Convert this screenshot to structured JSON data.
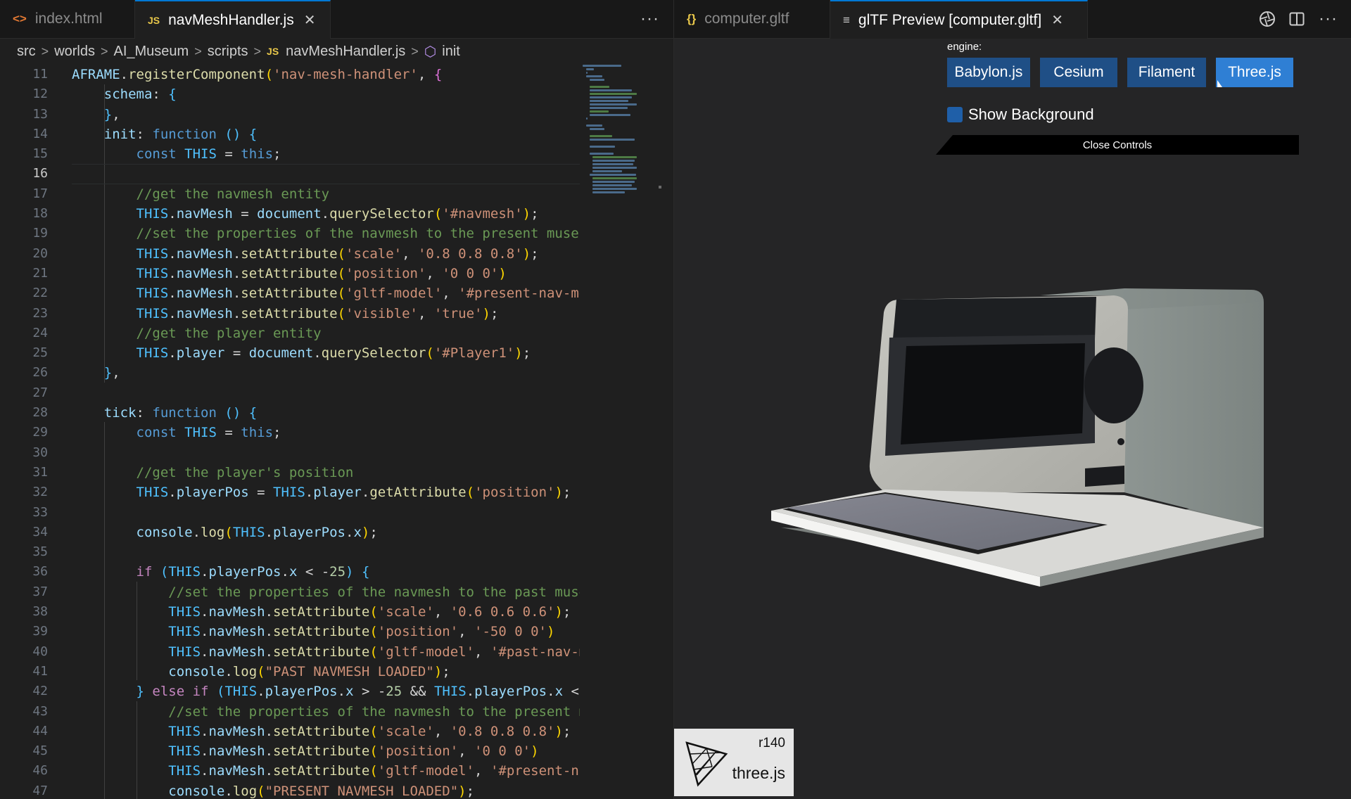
{
  "editor_tabs": [
    {
      "icon": "<>",
      "label": "index.html",
      "active": false
    },
    {
      "icon": "JS",
      "label": "navMeshHandler.js",
      "active": true
    }
  ],
  "preview_tabs": [
    {
      "icon": "{}",
      "label": "computer.gltf",
      "active": false
    },
    {
      "icon": "≡",
      "label": "glTF Preview [computer.gltf]",
      "active": true
    }
  ],
  "more_actions": "···",
  "breadcrumbs": [
    "src",
    "worlds",
    "AI_Museum",
    "scripts",
    "navMeshHandler.js",
    "init"
  ],
  "line_numbers": [
    "11",
    "12",
    "13",
    "14",
    "15",
    "16",
    "17",
    "18",
    "19",
    "20",
    "21",
    "22",
    "23",
    "24",
    "25",
    "26",
    "27",
    "28",
    "29",
    "30",
    "31",
    "32",
    "33",
    "34",
    "35",
    "36",
    "37",
    "38",
    "39",
    "40",
    "41",
    "42",
    "43",
    "44",
    "45",
    "46",
    "47"
  ],
  "current_line": "16",
  "code_lines": [
    [
      [
        "v",
        "AFRAME"
      ],
      [
        "d",
        "."
      ],
      [
        "f",
        "registerComponent"
      ],
      [
        "b",
        "("
      ],
      [
        "s",
        "'nav-mesh-handler'"
      ],
      [
        "d",
        ", "
      ],
      [
        "p",
        "{"
      ]
    ],
    [
      [
        "d",
        "    "
      ],
      [
        "v",
        "schema"
      ],
      [
        "d",
        ": "
      ],
      [
        "n",
        "{"
      ]
    ],
    [
      [
        "d",
        "    "
      ],
      [
        "n",
        "}"
      ],
      [
        "d",
        ","
      ]
    ],
    [
      [
        "d",
        "    "
      ],
      [
        "v",
        "init"
      ],
      [
        "d",
        ": "
      ],
      [
        "k",
        "function"
      ],
      [
        "d",
        " "
      ],
      [
        "n",
        "()"
      ],
      [
        "d",
        " "
      ],
      [
        "n",
        "{"
      ]
    ],
    [
      [
        "d",
        "        "
      ],
      [
        "k",
        "const"
      ],
      [
        "d",
        " "
      ],
      [
        "n",
        "THIS"
      ],
      [
        "d",
        " = "
      ],
      [
        "k",
        "this"
      ],
      [
        "d",
        ";"
      ]
    ],
    [
      [
        "d",
        ""
      ]
    ],
    [
      [
        "d",
        "        "
      ],
      [
        "c",
        "//get the navmesh entity"
      ]
    ],
    [
      [
        "d",
        "        "
      ],
      [
        "n",
        "THIS"
      ],
      [
        "d",
        "."
      ],
      [
        "v",
        "navMesh"
      ],
      [
        "d",
        " = "
      ],
      [
        "v",
        "document"
      ],
      [
        "d",
        "."
      ],
      [
        "f",
        "querySelector"
      ],
      [
        "b",
        "("
      ],
      [
        "s",
        "'#navmesh'"
      ],
      [
        "b",
        ")"
      ],
      [
        "d",
        ";"
      ]
    ],
    [
      [
        "d",
        "        "
      ],
      [
        "c",
        "//set the properties of the navmesh to the present museu"
      ]
    ],
    [
      [
        "d",
        "        "
      ],
      [
        "n",
        "THIS"
      ],
      [
        "d",
        "."
      ],
      [
        "v",
        "navMesh"
      ],
      [
        "d",
        "."
      ],
      [
        "f",
        "setAttribute"
      ],
      [
        "b",
        "("
      ],
      [
        "s",
        "'scale'"
      ],
      [
        "d",
        ", "
      ],
      [
        "s",
        "'0.8 0.8 0.8'"
      ],
      [
        "b",
        ")"
      ],
      [
        "d",
        ";"
      ]
    ],
    [
      [
        "d",
        "        "
      ],
      [
        "n",
        "THIS"
      ],
      [
        "d",
        "."
      ],
      [
        "v",
        "navMesh"
      ],
      [
        "d",
        "."
      ],
      [
        "f",
        "setAttribute"
      ],
      [
        "b",
        "("
      ],
      [
        "s",
        "'position'"
      ],
      [
        "d",
        ", "
      ],
      [
        "s",
        "'0 0 0'"
      ],
      [
        "b",
        ")"
      ]
    ],
    [
      [
        "d",
        "        "
      ],
      [
        "n",
        "THIS"
      ],
      [
        "d",
        "."
      ],
      [
        "v",
        "navMesh"
      ],
      [
        "d",
        "."
      ],
      [
        "f",
        "setAttribute"
      ],
      [
        "b",
        "("
      ],
      [
        "s",
        "'gltf-model'"
      ],
      [
        "d",
        ", "
      ],
      [
        "s",
        "'#present-nav-me"
      ]
    ],
    [
      [
        "d",
        "        "
      ],
      [
        "n",
        "THIS"
      ],
      [
        "d",
        "."
      ],
      [
        "v",
        "navMesh"
      ],
      [
        "d",
        "."
      ],
      [
        "f",
        "setAttribute"
      ],
      [
        "b",
        "("
      ],
      [
        "s",
        "'visible'"
      ],
      [
        "d",
        ", "
      ],
      [
        "s",
        "'true'"
      ],
      [
        "b",
        ")"
      ],
      [
        "d",
        ";"
      ]
    ],
    [
      [
        "d",
        "        "
      ],
      [
        "c",
        "//get the player entity"
      ]
    ],
    [
      [
        "d",
        "        "
      ],
      [
        "n",
        "THIS"
      ],
      [
        "d",
        "."
      ],
      [
        "v",
        "player"
      ],
      [
        "d",
        " = "
      ],
      [
        "v",
        "document"
      ],
      [
        "d",
        "."
      ],
      [
        "f",
        "querySelector"
      ],
      [
        "b",
        "("
      ],
      [
        "s",
        "'#Player1'"
      ],
      [
        "b",
        ")"
      ],
      [
        "d",
        ";"
      ]
    ],
    [
      [
        "d",
        "    "
      ],
      [
        "n",
        "}"
      ],
      [
        "d",
        ","
      ]
    ],
    [
      [
        "d",
        ""
      ]
    ],
    [
      [
        "d",
        "    "
      ],
      [
        "v",
        "tick"
      ],
      [
        "d",
        ": "
      ],
      [
        "k",
        "function"
      ],
      [
        "d",
        " "
      ],
      [
        "n",
        "()"
      ],
      [
        "d",
        " "
      ],
      [
        "n",
        "{"
      ]
    ],
    [
      [
        "d",
        "        "
      ],
      [
        "k",
        "const"
      ],
      [
        "d",
        " "
      ],
      [
        "n",
        "THIS"
      ],
      [
        "d",
        " = "
      ],
      [
        "k",
        "this"
      ],
      [
        "d",
        ";"
      ]
    ],
    [
      [
        "d",
        ""
      ]
    ],
    [
      [
        "d",
        "        "
      ],
      [
        "c",
        "//get the player's position"
      ]
    ],
    [
      [
        "d",
        "        "
      ],
      [
        "n",
        "THIS"
      ],
      [
        "d",
        "."
      ],
      [
        "v",
        "playerPos"
      ],
      [
        "d",
        " = "
      ],
      [
        "n",
        "THIS"
      ],
      [
        "d",
        "."
      ],
      [
        "v",
        "player"
      ],
      [
        "d",
        "."
      ],
      [
        "f",
        "getAttribute"
      ],
      [
        "b",
        "("
      ],
      [
        "s",
        "'position'"
      ],
      [
        "b",
        ")"
      ],
      [
        "d",
        ";"
      ]
    ],
    [
      [
        "d",
        ""
      ]
    ],
    [
      [
        "d",
        "        "
      ],
      [
        "v",
        "console"
      ],
      [
        "d",
        "."
      ],
      [
        "f",
        "log"
      ],
      [
        "b",
        "("
      ],
      [
        "n",
        "THIS"
      ],
      [
        "d",
        "."
      ],
      [
        "v",
        "playerPos"
      ],
      [
        "d",
        "."
      ],
      [
        "v",
        "x"
      ],
      [
        "b",
        ")"
      ],
      [
        "d",
        ";"
      ]
    ],
    [
      [
        "d",
        ""
      ]
    ],
    [
      [
        "d",
        "        "
      ],
      [
        "ctl",
        "if"
      ],
      [
        "d",
        " "
      ],
      [
        "n",
        "("
      ],
      [
        "n",
        "THIS"
      ],
      [
        "d",
        "."
      ],
      [
        "v",
        "playerPos"
      ],
      [
        "d",
        "."
      ],
      [
        "v",
        "x"
      ],
      [
        "d",
        " < -"
      ],
      [
        "num",
        "25"
      ],
      [
        "n",
        ")"
      ],
      [
        "d",
        " "
      ],
      [
        "n",
        "{"
      ]
    ],
    [
      [
        "d",
        "            "
      ],
      [
        "c",
        "//set the properties of the navmesh to the past muse"
      ]
    ],
    [
      [
        "d",
        "            "
      ],
      [
        "n",
        "THIS"
      ],
      [
        "d",
        "."
      ],
      [
        "v",
        "navMesh"
      ],
      [
        "d",
        "."
      ],
      [
        "f",
        "setAttribute"
      ],
      [
        "b",
        "("
      ],
      [
        "s",
        "'scale'"
      ],
      [
        "d",
        ", "
      ],
      [
        "s",
        "'0.6 0.6 0.6'"
      ],
      [
        "b",
        ")"
      ],
      [
        "d",
        ";"
      ]
    ],
    [
      [
        "d",
        "            "
      ],
      [
        "n",
        "THIS"
      ],
      [
        "d",
        "."
      ],
      [
        "v",
        "navMesh"
      ],
      [
        "d",
        "."
      ],
      [
        "f",
        "setAttribute"
      ],
      [
        "b",
        "("
      ],
      [
        "s",
        "'position'"
      ],
      [
        "d",
        ", "
      ],
      [
        "s",
        "'-50 0 0'"
      ],
      [
        "b",
        ")"
      ]
    ],
    [
      [
        "d",
        "            "
      ],
      [
        "n",
        "THIS"
      ],
      [
        "d",
        "."
      ],
      [
        "v",
        "navMesh"
      ],
      [
        "d",
        "."
      ],
      [
        "f",
        "setAttribute"
      ],
      [
        "b",
        "("
      ],
      [
        "s",
        "'gltf-model'"
      ],
      [
        "d",
        ", "
      ],
      [
        "s",
        "'#past-nav-m"
      ]
    ],
    [
      [
        "d",
        "            "
      ],
      [
        "v",
        "console"
      ],
      [
        "d",
        "."
      ],
      [
        "f",
        "log"
      ],
      [
        "b",
        "("
      ],
      [
        "s",
        "\"PAST NAVMESH LOADED\""
      ],
      [
        "b",
        ")"
      ],
      [
        "d",
        ";"
      ]
    ],
    [
      [
        "d",
        "        "
      ],
      [
        "n",
        "}"
      ],
      [
        "d",
        " "
      ],
      [
        "ctl",
        "else"
      ],
      [
        "d",
        " "
      ],
      [
        "ctl",
        "if"
      ],
      [
        "d",
        " "
      ],
      [
        "n",
        "("
      ],
      [
        "n",
        "THIS"
      ],
      [
        "d",
        "."
      ],
      [
        "v",
        "playerPos"
      ],
      [
        "d",
        "."
      ],
      [
        "v",
        "x"
      ],
      [
        "d",
        " > -"
      ],
      [
        "num",
        "25"
      ],
      [
        "d",
        " && "
      ],
      [
        "n",
        "THIS"
      ],
      [
        "d",
        "."
      ],
      [
        "v",
        "playerPos"
      ],
      [
        "d",
        "."
      ],
      [
        "v",
        "x"
      ],
      [
        "d",
        " <"
      ]
    ],
    [
      [
        "d",
        "            "
      ],
      [
        "c",
        "//set the properties of the navmesh to the present m"
      ]
    ],
    [
      [
        "d",
        "            "
      ],
      [
        "n",
        "THIS"
      ],
      [
        "d",
        "."
      ],
      [
        "v",
        "navMesh"
      ],
      [
        "d",
        "."
      ],
      [
        "f",
        "setAttribute"
      ],
      [
        "b",
        "("
      ],
      [
        "s",
        "'scale'"
      ],
      [
        "d",
        ", "
      ],
      [
        "s",
        "'0.8 0.8 0.8'"
      ],
      [
        "b",
        ")"
      ],
      [
        "d",
        ";"
      ]
    ],
    [
      [
        "d",
        "            "
      ],
      [
        "n",
        "THIS"
      ],
      [
        "d",
        "."
      ],
      [
        "v",
        "navMesh"
      ],
      [
        "d",
        "."
      ],
      [
        "f",
        "setAttribute"
      ],
      [
        "b",
        "("
      ],
      [
        "s",
        "'position'"
      ],
      [
        "d",
        ", "
      ],
      [
        "s",
        "'0 0 0'"
      ],
      [
        "b",
        ")"
      ]
    ],
    [
      [
        "d",
        "            "
      ],
      [
        "n",
        "THIS"
      ],
      [
        "d",
        "."
      ],
      [
        "v",
        "navMesh"
      ],
      [
        "d",
        "."
      ],
      [
        "f",
        "setAttribute"
      ],
      [
        "b",
        "("
      ],
      [
        "s",
        "'gltf-model'"
      ],
      [
        "d",
        ", "
      ],
      [
        "s",
        "'#present-na"
      ]
    ],
    [
      [
        "d",
        "            "
      ],
      [
        "v",
        "console"
      ],
      [
        "d",
        "."
      ],
      [
        "f",
        "log"
      ],
      [
        "b",
        "("
      ],
      [
        "s",
        "\"PRESENT NAVMESH LOADED\""
      ],
      [
        "b",
        ")"
      ],
      [
        "d",
        ";"
      ]
    ]
  ],
  "preview": {
    "engine_label": "engine:",
    "engines": [
      "Babylon.js",
      "Cesium",
      "Filament",
      "Three.js"
    ],
    "selected_engine": "Three.js",
    "show_background_label": "Show Background",
    "close_controls_label": "Close Controls",
    "threejs_badge": {
      "revision": "r140",
      "name": "three.js"
    }
  },
  "colors": {
    "accent": "#0078d4",
    "engine_button": "#1f4f86",
    "engine_selected": "#2f7fd4"
  }
}
